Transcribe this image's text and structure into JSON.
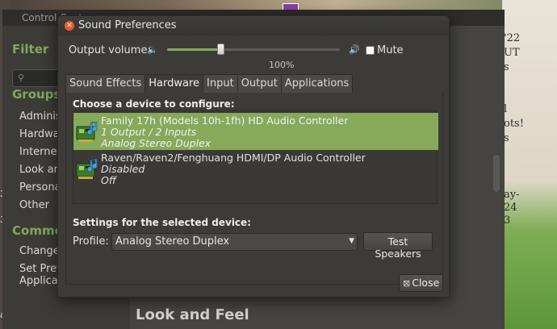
{
  "background": {
    "cc_title": "Control Center",
    "filter_heading": "Filter",
    "groups_heading": "Groups",
    "groups": [
      "Administ",
      "Hardwa",
      "Internet",
      "Look and",
      "Persona",
      "Other"
    ],
    "common_heading": "Commo",
    "common_items": [
      "Change T",
      "Set Pref",
      "Applicat"
    ],
    "look_and_feel": "Look and Feel",
    "right_text": [
      "'22",
      "UT",
      "s",
      "l",
      "ots!",
      "s",
      "ay-",
      "24",
      "3"
    ],
    "left_text": [
      "3",
      "3",
      "a"
    ]
  },
  "dialog": {
    "title": "Sound Preferences",
    "close_glyph": "✕",
    "output_volume_label": "Output volume:",
    "volume_percent_text": "100%",
    "volume_level": 0.3,
    "mute_label": "Mute",
    "mute_checked": false,
    "tabs": [
      {
        "label": "Sound Effects",
        "active": false
      },
      {
        "label": "Hardware",
        "active": true
      },
      {
        "label": "Input",
        "active": false
      },
      {
        "label": "Output",
        "active": false
      },
      {
        "label": "Applications",
        "active": false
      }
    ],
    "choose_device_label": "Choose a device to configure:",
    "devices": [
      {
        "name": "Family 17h (Models 10h-1fh) HD Audio Controller",
        "line2": "1 Output / 2 Inputs",
        "line3": "Analog Stereo Duplex",
        "selected": true
      },
      {
        "name": "Raven/Raven2/Fenghuang HDMI/DP Audio Controller",
        "line2": "Disabled",
        "line3": "Off",
        "selected": false
      }
    ],
    "settings_label": "Settings for the selected device:",
    "profile_label": "Profile:",
    "profile_value": "Analog Stereo Duplex",
    "test_speakers_label": "Test Speakers",
    "close_button_label": "Close"
  },
  "colors": {
    "accent": "#86a95a",
    "close_button": "#e95a2a",
    "dialog_bg": "#3c3b37"
  }
}
